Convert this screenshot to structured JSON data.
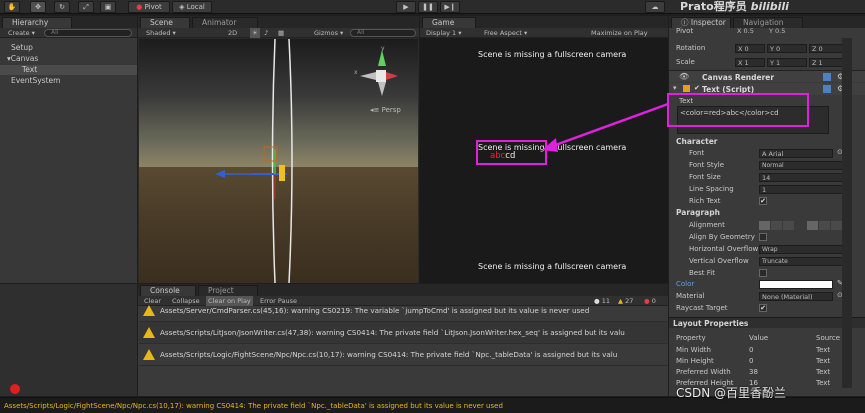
{
  "toolbar": {
    "pivot": "Pivot",
    "local": "Local",
    "watermark": "Prato程序员"
  },
  "hierarchy": {
    "tab": "Hierarchy",
    "create": "Create",
    "search": "All",
    "items": [
      "Setup",
      "Canvas",
      "Text",
      "EventSystem"
    ]
  },
  "scene": {
    "tab_scene": "Scene",
    "tab_animator": "Animator",
    "shading": "Shaded",
    "mode_2d": "2D",
    "gizmos": "Gizmos",
    "search": "All",
    "persp": "Persp",
    "axis_y": "y",
    "axis_x": "x",
    "axis_z": "z"
  },
  "game": {
    "tab": "Game",
    "display": "Display 1",
    "aspect": "Free Aspect",
    "maximize": "Maximize on Play",
    "msg_top": "Scene is missing a fullscreen camera",
    "msg_mid": "Scene is missing a fullscreen camera",
    "red_text": "abc",
    "plain_text": "cd",
    "msg_bottom": "Scene is missing a fullscreen camera"
  },
  "inspector": {
    "tab_inspector": "Inspector",
    "tab_navigation": "Navigation",
    "pivot_label": "Pivot",
    "pivot_x": "X 0.5",
    "pivot_y": "Y 0.5",
    "rotation_label": "Rotation",
    "rot_x": "X 0",
    "rot_y": "Y 0",
    "rot_z": "Z 0",
    "scale_label": "Scale",
    "scale_x": "X 1",
    "scale_y": "Y 1",
    "scale_z": "Z 1",
    "canvas_renderer": "Canvas Renderer",
    "text_script": "Text (Script)",
    "text_label": "Text",
    "text_value": "<color=red>abc</color>cd",
    "character": "Character",
    "font_label": "Font",
    "font_value": "Arial",
    "font_style_label": "Font Style",
    "font_style_value": "Normal",
    "font_size_label": "Font Size",
    "font_size_value": "14",
    "line_spacing_label": "Line Spacing",
    "line_spacing_value": "1",
    "rich_text_label": "Rich Text",
    "paragraph": "Paragraph",
    "alignment_label": "Alignment",
    "align_geometry_label": "Align By Geometry",
    "h_overflow_label": "Horizontal Overflow",
    "h_overflow_value": "Wrap",
    "v_overflow_label": "Vertical Overflow",
    "v_overflow_value": "Truncate",
    "best_fit_label": "Best Fit",
    "color_label": "Color",
    "material_label": "Material",
    "material_value": "None (Material)",
    "raycast_label": "Raycast Target",
    "layout_properties": "Layout Properties",
    "lp_headers": [
      "Property",
      "Value",
      "Source"
    ],
    "lp_rows": [
      [
        "Min Width",
        "0",
        "Text"
      ],
      [
        "Min Height",
        "0",
        "Text"
      ],
      [
        "Preferred Width",
        "38",
        "Text"
      ],
      [
        "Preferred Height",
        "16",
        "Text"
      ]
    ]
  },
  "console": {
    "tab_console": "Console",
    "tab_project": "Project",
    "clear": "Clear",
    "collapse": "Collapse",
    "clear_on_play": "Clear on Play",
    "error_pause": "Error Pause",
    "count_info": "11",
    "count_warn": "27",
    "count_err": "0",
    "logs": [
      "Assets/Server/CmdParser.cs(45,16): warning CS0219: The variable `jumpToCmd' is assigned but its value is never used",
      "Assets/Scripts/LitJson/JsonWriter.cs(47,38): warning CS0414: The private field `LitJson.JsonWriter.hex_seq' is assigned but its valu",
      "Assets/Scripts/Logic/FightScene/Npc/Npc.cs(10,17): warning CS0414: The private field `Npc._tableData' is assigned but its valu"
    ],
    "status": "Assets/Scripts/Logic/FightScene/Npc/Npc.cs(10,17): warning CS0414: The private field `Npc._tableData' is assigned but its value is never used"
  },
  "watermark_csdn": "CSDN @百里香酚兰",
  "colors": {
    "highlight": "#e020e0",
    "red_text": "#ff2020",
    "accent": "#3a6ea5"
  }
}
